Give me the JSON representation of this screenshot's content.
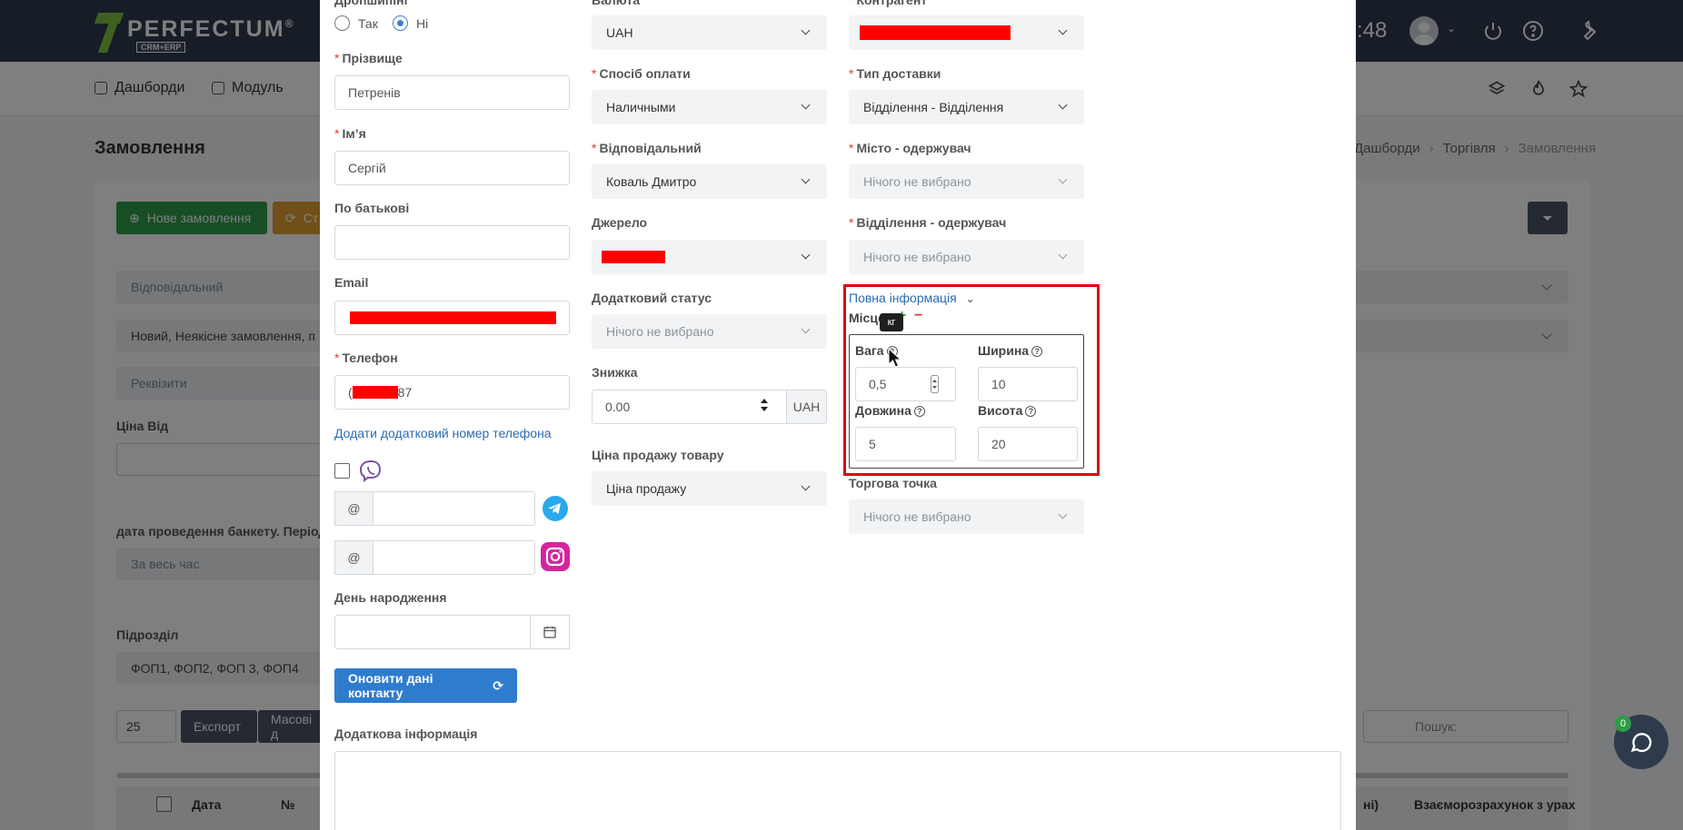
{
  "header": {
    "logo_text": "PERFECTUM",
    "logo_reg": "®",
    "logo_sub": "CRM+ERP",
    "time_fragment": ":48"
  },
  "subnav": {
    "items": [
      {
        "label": "Дашборди"
      },
      {
        "label": "Модуль"
      }
    ]
  },
  "page": {
    "title": "Замовлення",
    "breadcrumbs": [
      "Дашборди",
      "Торгівля",
      "Замовлення"
    ]
  },
  "background": {
    "new_order_label": "Нове замовлення",
    "status_btn_label": "Ст",
    "filters": {
      "responsible_placeholder": "Відповідальний",
      "status_value": "Новий, Неякісне замовлення, п",
      "requisites_placeholder": "Реквізити",
      "price_from_label": "Ціна Від",
      "banquet_label": "дата проведення банкету. Період",
      "period_value": "За весь час",
      "division_label": "Підрозділ",
      "division_value": "ФОП1, ФОП2, ФОП 3, ФОП4"
    },
    "table": {
      "page_size": "25",
      "export_label": "Експорт",
      "mass_label": "Масові д",
      "search_placeholder": "Пошук:",
      "col_date": "Дата",
      "col_no": "№",
      "col_right_1": "ні)",
      "col_right_2": "Взаєморозрахунок з урах"
    },
    "chat_badge": "0"
  },
  "modal": {
    "dropshipping_label": "Дропшипінг",
    "radio_yes": "Так",
    "radio_no": "Ні",
    "radio_selected": "Ні",
    "surname": {
      "label": "Прізвище",
      "value": "Петренів"
    },
    "first_name": {
      "label": "Ім’я",
      "value": "Сергій"
    },
    "patronymic": {
      "label": "По батькові",
      "value": ""
    },
    "email": {
      "label": "Email"
    },
    "phone": {
      "label": "Телефон",
      "value_tail": "87",
      "prefix": "("
    },
    "add_phone_link": "Додати додатковий номер телефона",
    "at_symbol": "@",
    "birthday_label": "День народження",
    "update_contact_btn": "Оновити дані контакту",
    "additional_info_label": "Додаткова інформація",
    "currency": {
      "label": "Валюта",
      "value": "UAH"
    },
    "payment_method": {
      "label": "Спосіб оплати",
      "value": "Наличными"
    },
    "responsible": {
      "label": "Відповідальний",
      "value": "Коваль Дмитро"
    },
    "source": {
      "label": "Джерело"
    },
    "additional_status": {
      "label": "Додатковий статус",
      "value": "Нічого не вибрано"
    },
    "discount": {
      "label": "Знижка",
      "value": "0.00",
      "unit": "UAH"
    },
    "sale_price": {
      "label": "Ціна продажу товару",
      "value": "Ціна продажу"
    },
    "counterparty": {
      "label": "Контрагент"
    },
    "delivery_type": {
      "label": "Тип доставки",
      "value": "Відділення - Відділення"
    },
    "city": {
      "label": "Місто - одержувач",
      "value": "Нічого не вибрано"
    },
    "branch": {
      "label": "Відділення - одержувач",
      "value": "Нічого не вибрано"
    },
    "full_info_link": "Повна інформація",
    "places_label": "Місце",
    "plus": "+",
    "minus": "−",
    "tooltip": "кг",
    "weight": {
      "label": "Вага",
      "value": "0,5"
    },
    "width": {
      "label": "Ширина",
      "value": "10"
    },
    "length": {
      "label": "Довжина",
      "value": "5"
    },
    "height": {
      "label": "Висота",
      "value": "20"
    },
    "sales_point": {
      "label": "Торгова точка",
      "value": "Нічого не вибрано"
    }
  }
}
